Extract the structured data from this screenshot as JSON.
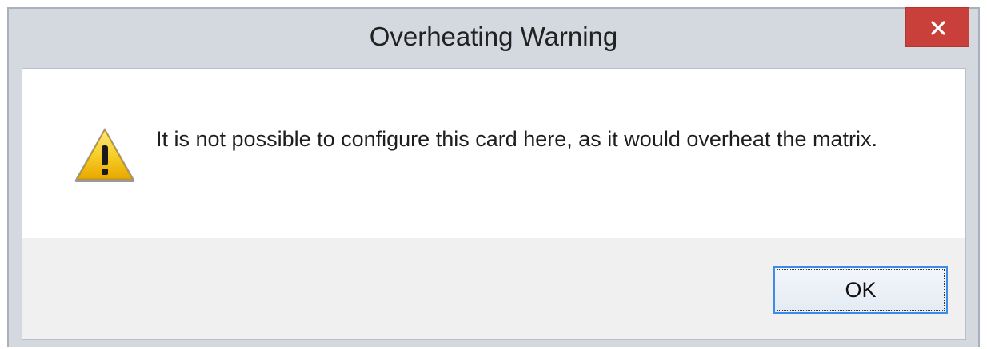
{
  "window": {
    "title": "Overheating Warning"
  },
  "titlebar": {
    "close_icon": "close-icon"
  },
  "dialog": {
    "icon": "warning-icon",
    "message": "It is not possible to configure this card here, as it would overheat the matrix."
  },
  "buttons": {
    "ok_label": "OK"
  },
  "colors": {
    "close_button": "#c9403a",
    "focus_border": "#3c8ce8",
    "warning_yellow": "#f5c400"
  }
}
